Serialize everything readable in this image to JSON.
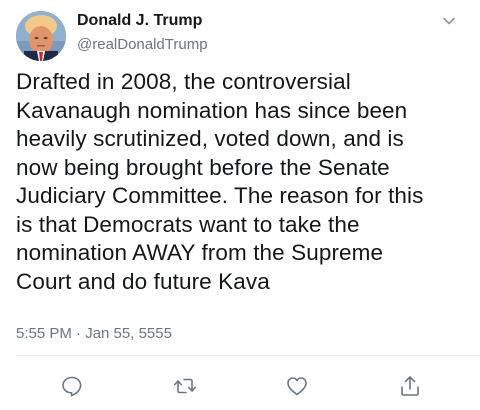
{
  "tweet": {
    "author": {
      "display_name": "Donald J. Trump",
      "handle": "@realDonaldTrump",
      "avatar_icon": "profile-photo"
    },
    "menu_icon": "chevron-down-icon",
    "text_lines": [
      "Drafted in 2008, the controversial",
      "Kavanaugh nomination has since been",
      "heavily scrutinized, voted down, and is",
      "now being brought before the Senate",
      "Judiciary Committee. The reason for this",
      "is that Democrats want to take the",
      "nomination AWAY from the Supreme",
      "Court and do future Kava"
    ],
    "timestamp": "5:55 PM · Jan 55, 5555",
    "actions": [
      {
        "name": "reply",
        "icon": "comment-icon"
      },
      {
        "name": "retweet",
        "icon": "retweet-icon"
      },
      {
        "name": "like",
        "icon": "heart-icon"
      },
      {
        "name": "share",
        "icon": "share-icon"
      }
    ],
    "colors": {
      "text": "#14171a",
      "secondary": "#657786",
      "divider": "#e6ecf0",
      "icon": "#657786"
    }
  }
}
